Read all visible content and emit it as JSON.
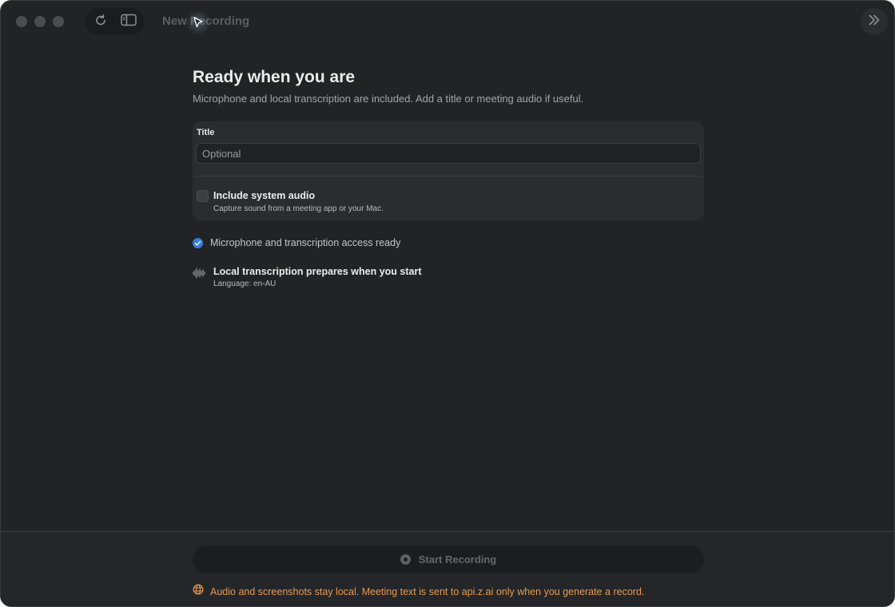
{
  "window": {
    "title": "New Recording"
  },
  "main": {
    "heading": "Ready when you are",
    "subheading": "Microphone and local transcription are included. Add a title or meeting audio if useful.",
    "card": {
      "title_label": "Title",
      "title_placeholder": "Optional",
      "title_value": "",
      "system_audio_label": "Include system audio",
      "system_audio_description": "Capture sound from a meeting app or your Mac.",
      "system_audio_checked": false
    },
    "status_text": "Microphone and transcription access ready",
    "transcription": {
      "title": "Local transcription prepares when you start",
      "language": "Language: en-AU"
    }
  },
  "footer": {
    "start_label": "Start Recording",
    "privacy_text": "Audio and screenshots stay local. Meeting text is sent to api.z.ai only when you generate a record."
  },
  "colors": {
    "background": "#212325",
    "accent_blue": "#3a7bdc",
    "privacy_orange": "#e79a4f"
  },
  "icons": {
    "refresh": "refresh-icon",
    "sidebar": "sidebar-toggle-icon",
    "expand": "double-chevron-right-icon",
    "status": "checkmark-circle-icon",
    "waveform": "waveform-icon",
    "record": "record-icon",
    "globe": "globe-icon"
  }
}
